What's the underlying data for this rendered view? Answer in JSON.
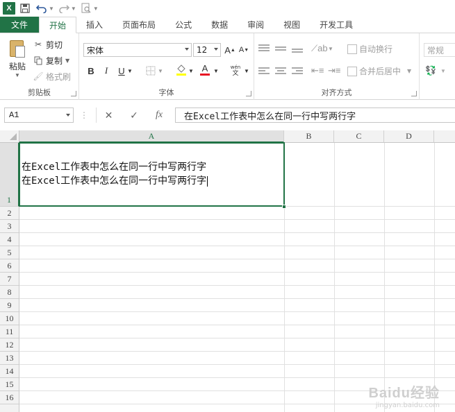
{
  "app": {
    "logo_text": "X"
  },
  "quick_access": {
    "items": [
      "excel-logo",
      "save-icon",
      "undo-icon",
      "redo-icon",
      "print-preview-icon",
      "customize-icon"
    ]
  },
  "tabs": [
    "文件",
    "开始",
    "插入",
    "页面布局",
    "公式",
    "数据",
    "审阅",
    "视图",
    "开发工具"
  ],
  "active_tab": "开始",
  "ribbon": {
    "clipboard": {
      "label": "剪贴板",
      "paste": "粘贴",
      "cut": "剪切",
      "copy": "复制",
      "format_painter": "格式刷"
    },
    "font": {
      "label": "字体",
      "font_name": "宋体",
      "font_size": "12",
      "bold": "B",
      "italic": "I",
      "underline": "U",
      "font_color": "#e81123"
    },
    "alignment": {
      "label": "对齐方式",
      "wrap_text": "自动换行",
      "merge_center": "合并后居中"
    },
    "number": {
      "format": "常规"
    }
  },
  "formula_bar": {
    "name_box": "A1",
    "cancel": "✕",
    "enter": "✓",
    "fx": "fx",
    "content": "在Excel工作表中怎么在同一行中写两行字"
  },
  "sheet": {
    "columns": [
      "A",
      "B",
      "C",
      "D"
    ],
    "rows": [
      "1",
      "2",
      "3",
      "4",
      "5",
      "6",
      "7",
      "8",
      "9",
      "10",
      "11",
      "12",
      "13",
      "14",
      "15",
      "16"
    ],
    "selected_column": "A",
    "selected_row": "1",
    "cell_a1_line1": "在Excel工作表中怎么在同一行中写两行字",
    "cell_a1_line2": "在Excel工作表中怎么在同一行中写两行字"
  },
  "watermark": {
    "main": "Baidu经验",
    "sub": "jingyan.baidu.com"
  },
  "colors": {
    "accent": "#217346",
    "header_bg": "#f2f2f2",
    "gridline": "#e0e0e0"
  }
}
